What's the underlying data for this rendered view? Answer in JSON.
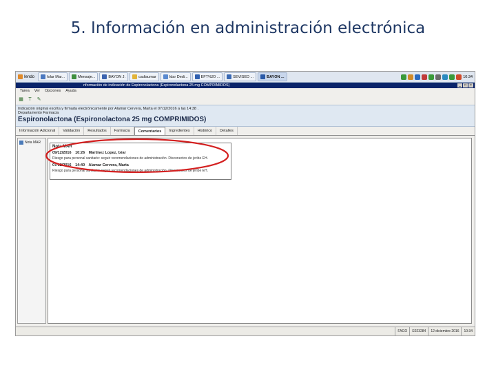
{
  "slide": {
    "title": "5. Información en administración electrónica"
  },
  "taskbar": {
    "start_label": "Iendo",
    "items": [
      {
        "label": "Iolar Mar...",
        "icon": "app-icon",
        "color": "#4a78c0"
      },
      {
        "label": "Mensaje...",
        "icon": "mail-icon",
        "color": "#3f8f3f"
      },
      {
        "label": "BAYON J.",
        "icon": "app-icon",
        "color": "#3c64b0"
      },
      {
        "label": "cadiaumar",
        "icon": "folder-icon",
        "color": "#e2b43a"
      },
      {
        "label": "Idar Dedi...",
        "icon": "document-icon",
        "color": "#5a8ad0"
      },
      {
        "label": "EFT%20 ...",
        "icon": "document-icon",
        "color": "#3060b0"
      },
      {
        "label": "SEVISED ...",
        "icon": "document-icon",
        "color": "#3a6ab4"
      },
      {
        "label": "BAYON ...",
        "icon": "app-icon",
        "color": "#2a5aa8",
        "active": true
      }
    ],
    "clock": "10:34"
  },
  "window": {
    "title": "nformación de indicación de Espironolactona (Espironolactona 25 mg COMPRIMIDOS)",
    "menu": [
      "Tarea",
      "Ver",
      "Opciones",
      "Ayuda"
    ]
  },
  "info": {
    "line1": "Indicación original escrita y firmada electrónicamente por Alamar Cervera, Marta el 07/12/2016 a las 14:38 .",
    "line2": "Departamento Farmacia",
    "drug": "Espironolactona (Espironolactona 25 mg COMPRIMIDOS)"
  },
  "tabs": [
    "Información Adicional",
    "Validación",
    "Resultados",
    "Farmacia",
    "Comentarios",
    "Ingredientes",
    "Histórico",
    "Detalles"
  ],
  "active_tab": "Comentarios",
  "leftnav": {
    "item": "Nota MAR"
  },
  "notes": {
    "title": "Nota MAR",
    "entries": [
      {
        "date": "09/12/2016",
        "time": "10:26",
        "author": "Martinez Lopez, Ixiar",
        "text": "Riesgo para personal sanitario: seguir recomendaciones de administración. Disconectos de jeribe EH."
      },
      {
        "date": "07/12/2016",
        "time": "14:40",
        "author": "Alamar Cervera, Marta",
        "text": "Riesgo para personal sanitario: seguir recomendaciones de administración. Disconectos de jeribe EH."
      }
    ]
  },
  "statusbar": {
    "user": "FAGO",
    "code": "E023284",
    "date": "12 diciembre 2016",
    "time": "10:34"
  }
}
